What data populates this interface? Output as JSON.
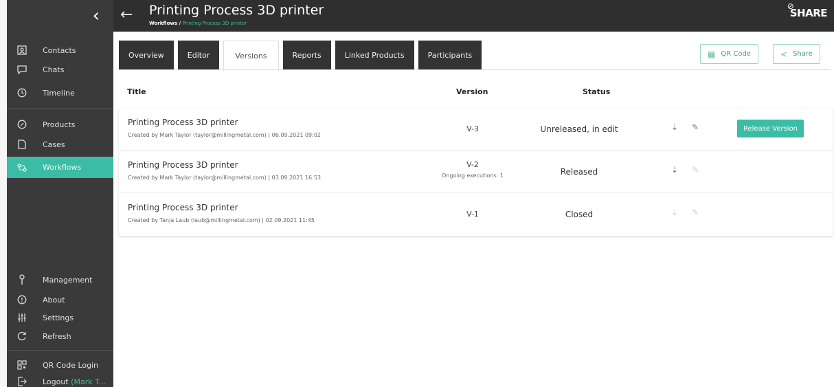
{
  "app": {
    "brand": "SHARE"
  },
  "header": {
    "title": "Printing Process 3D printer",
    "breadcrumb_root": "Workflows /",
    "breadcrumb_current": "Printing Process 3D printer"
  },
  "sidebar": {
    "items": [
      {
        "label": "Contacts",
        "icon": "contacts-icon"
      },
      {
        "label": "Chats",
        "icon": "chat-icon"
      },
      {
        "label": "Timeline",
        "icon": "clock-icon"
      },
      {
        "label": "Products",
        "icon": "products-icon"
      },
      {
        "label": "Cases",
        "icon": "cases-icon"
      },
      {
        "label": "Workflows",
        "icon": "workflows-icon",
        "active": true
      },
      {
        "label": "Management",
        "icon": "wrench-icon"
      },
      {
        "label": "About",
        "icon": "info-icon"
      },
      {
        "label": "Settings",
        "icon": "sliders-icon"
      },
      {
        "label": "Refresh",
        "icon": "refresh-icon"
      },
      {
        "label": "QR Code Login",
        "icon": "qr-icon"
      },
      {
        "label": "Logout",
        "sublabel": "(Mark T...",
        "icon": "logout-icon"
      }
    ]
  },
  "tabs": [
    {
      "label": "Overview"
    },
    {
      "label": "Editor"
    },
    {
      "label": "Versions",
      "active": true
    },
    {
      "label": "Reports"
    },
    {
      "label": "Linked Products"
    },
    {
      "label": "Participants"
    }
  ],
  "actions": {
    "qr_label": "QR Code",
    "share_label": "Share"
  },
  "table": {
    "headers": {
      "title": "Title",
      "version": "Version",
      "status": "Status"
    },
    "rows": [
      {
        "title": "Printing Process 3D printer",
        "meta": "Created by Mark Taylor (taylor@millingmetal.com) | 06.09.2021 09:02",
        "version": "V-3",
        "version_note": "",
        "status": "Unreleased, in edit",
        "action": "Release Version"
      },
      {
        "title": "Printing Process 3D printer",
        "meta": "Created by Mark Taylor (taylor@millingmetal.com) | 03.09.2021 16:53",
        "version": "V-2",
        "version_note": "Ongoing executions: 1",
        "status": "Released",
        "action": ""
      },
      {
        "title": "Printing Process 3D printer",
        "meta": "Created by Tanja Laub (laub@millingmetal.com) | 02.09.2021 11:45",
        "version": "V-1",
        "version_note": "",
        "status": "Closed",
        "action": ""
      }
    ]
  },
  "colors": {
    "accent": "#3bbca4",
    "sidebar": "#3a3a3a",
    "header": "#2f2f2f",
    "tab": "#333333"
  }
}
